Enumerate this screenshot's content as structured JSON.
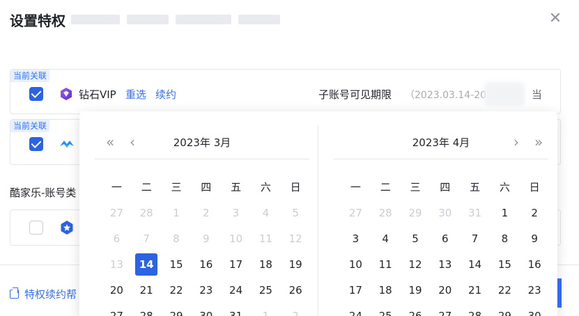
{
  "dialog": {
    "title": "设置特权",
    "close_glyph": "✕"
  },
  "cards": [
    {
      "badge": "当前关联",
      "checked": true,
      "product": "钻石VIP",
      "reselect": "重选",
      "renew": "续约",
      "visible_label": "子账号可见期限",
      "visible_value": "（2023.03.14-202",
      "tail": "当"
    },
    {
      "badge": "当前关联",
      "checked": true
    },
    {
      "checked": false
    }
  ],
  "section_label": "酷家乐-账号类",
  "footer": {
    "link_label": "特权续约帮"
  },
  "icons": {
    "vip": "diamond-vip-icon",
    "product2": "wave-logo-icon",
    "product3": "star-badge-icon",
    "close": "close-icon",
    "external": "external-link-icon"
  },
  "colors": {
    "accent": "#3370ff",
    "checkbox": "#2c63e0",
    "vip_purple": "#7b3fe4"
  },
  "datepicker": {
    "nav": {
      "prev_year": "«",
      "prev_month": "‹",
      "next_month": "›",
      "next_year": "»"
    },
    "weekdays": [
      "一",
      "二",
      "三",
      "四",
      "五",
      "六",
      "日"
    ],
    "months": [
      {
        "title": "2023年 3月",
        "days": [
          [
            "27",
            "28",
            "1",
            "2",
            "3",
            "4",
            "5"
          ],
          [
            "6",
            "7",
            "8",
            "9",
            "10",
            "11",
            "12"
          ],
          [
            "13",
            "14",
            "15",
            "16",
            "17",
            "18",
            "19"
          ],
          [
            "20",
            "21",
            "22",
            "23",
            "24",
            "25",
            "26"
          ],
          [
            "27",
            "28",
            "29",
            "30",
            "31",
            "1",
            "2"
          ]
        ],
        "muted": [
          [
            0,
            0
          ],
          [
            0,
            1
          ],
          [
            0,
            2
          ],
          [
            0,
            3
          ],
          [
            0,
            4
          ],
          [
            0,
            5
          ],
          [
            0,
            6
          ],
          [
            1,
            0
          ],
          [
            1,
            1
          ],
          [
            1,
            2
          ],
          [
            1,
            3
          ],
          [
            1,
            4
          ],
          [
            1,
            5
          ],
          [
            1,
            6
          ],
          [
            2,
            0
          ],
          [
            4,
            5
          ],
          [
            4,
            6
          ]
        ],
        "selected": [
          2,
          1
        ]
      },
      {
        "title": "2023年 4月",
        "days": [
          [
            "27",
            "28",
            "29",
            "30",
            "31",
            "1",
            "2"
          ],
          [
            "3",
            "4",
            "5",
            "6",
            "7",
            "8",
            "9"
          ],
          [
            "10",
            "11",
            "12",
            "13",
            "14",
            "15",
            "16"
          ],
          [
            "17",
            "18",
            "19",
            "20",
            "21",
            "22",
            "23"
          ],
          [
            "24",
            "25",
            "26",
            "27",
            "28",
            "29",
            "30"
          ]
        ],
        "muted": [
          [
            0,
            0
          ],
          [
            0,
            1
          ],
          [
            0,
            2
          ],
          [
            0,
            3
          ],
          [
            0,
            4
          ]
        ],
        "selected": null
      }
    ]
  }
}
